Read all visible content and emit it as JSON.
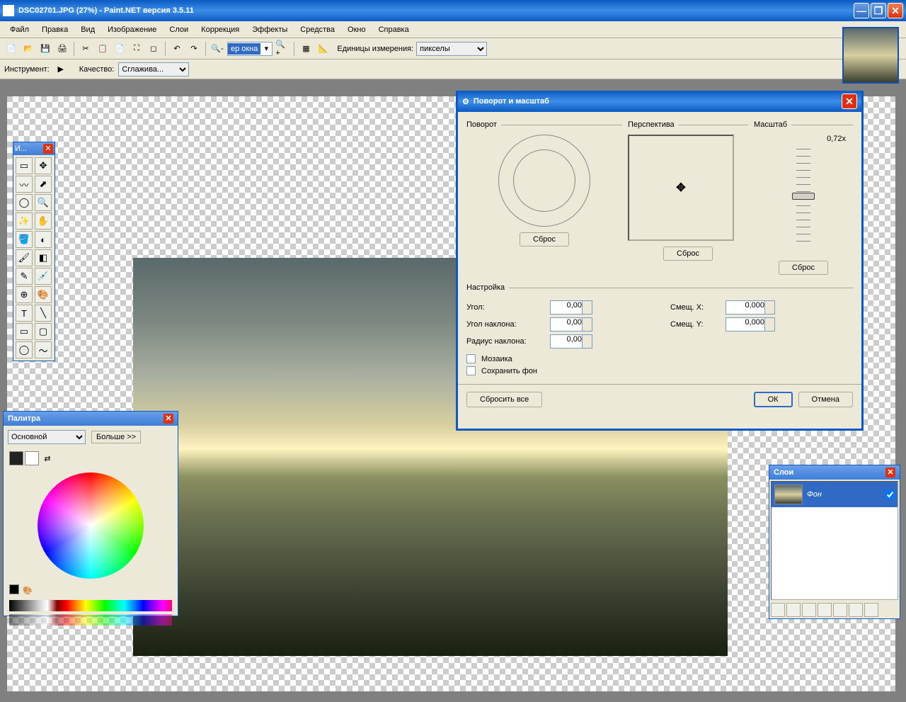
{
  "title": "DSC02701.JPG (27%) - Paint.NET версия 3.5.11",
  "menu": [
    "Файл",
    "Правка",
    "Вид",
    "Изображение",
    "Слои",
    "Коррекция",
    "Эффекты",
    "Средства",
    "Окно",
    "Справка"
  ],
  "toolbar1": {
    "zoom_text": "ер окна",
    "units_label": "Единицы измерения:",
    "units_value": "пикселы"
  },
  "toolbar2": {
    "tool_label": "Инструмент:",
    "quality_label": "Качество:",
    "quality_value": "Сглажива..."
  },
  "tools_window": {
    "title": "И..."
  },
  "colors_window": {
    "title": "Палитра",
    "mode": "Основной",
    "more": "Больше >>"
  },
  "layers_window": {
    "title": "Слои",
    "layer_name": "Фон"
  },
  "dialog": {
    "title": "Поворот и масштаб",
    "rotation": "Поворот",
    "perspective": "Перспектива",
    "scale": "Масштаб",
    "scale_value": "0,72x",
    "reset": "Сброс",
    "settings": "Настройка",
    "angle": "Угол:",
    "angle_val": "0,00",
    "tilt_angle": "Угол наклона:",
    "tilt_val": "0,00",
    "tilt_radius": "Радиус наклона:",
    "radius_val": "0,00",
    "offset_x": "Смещ. X:",
    "ox_val": "0,000",
    "offset_y": "Смещ. Y:",
    "oy_val": "0,000",
    "mosaic": "Мозаика",
    "keep_bg": "Сохранить фон",
    "reset_all": "Сбросить все",
    "ok": "ОК",
    "cancel": "Отмена"
  }
}
